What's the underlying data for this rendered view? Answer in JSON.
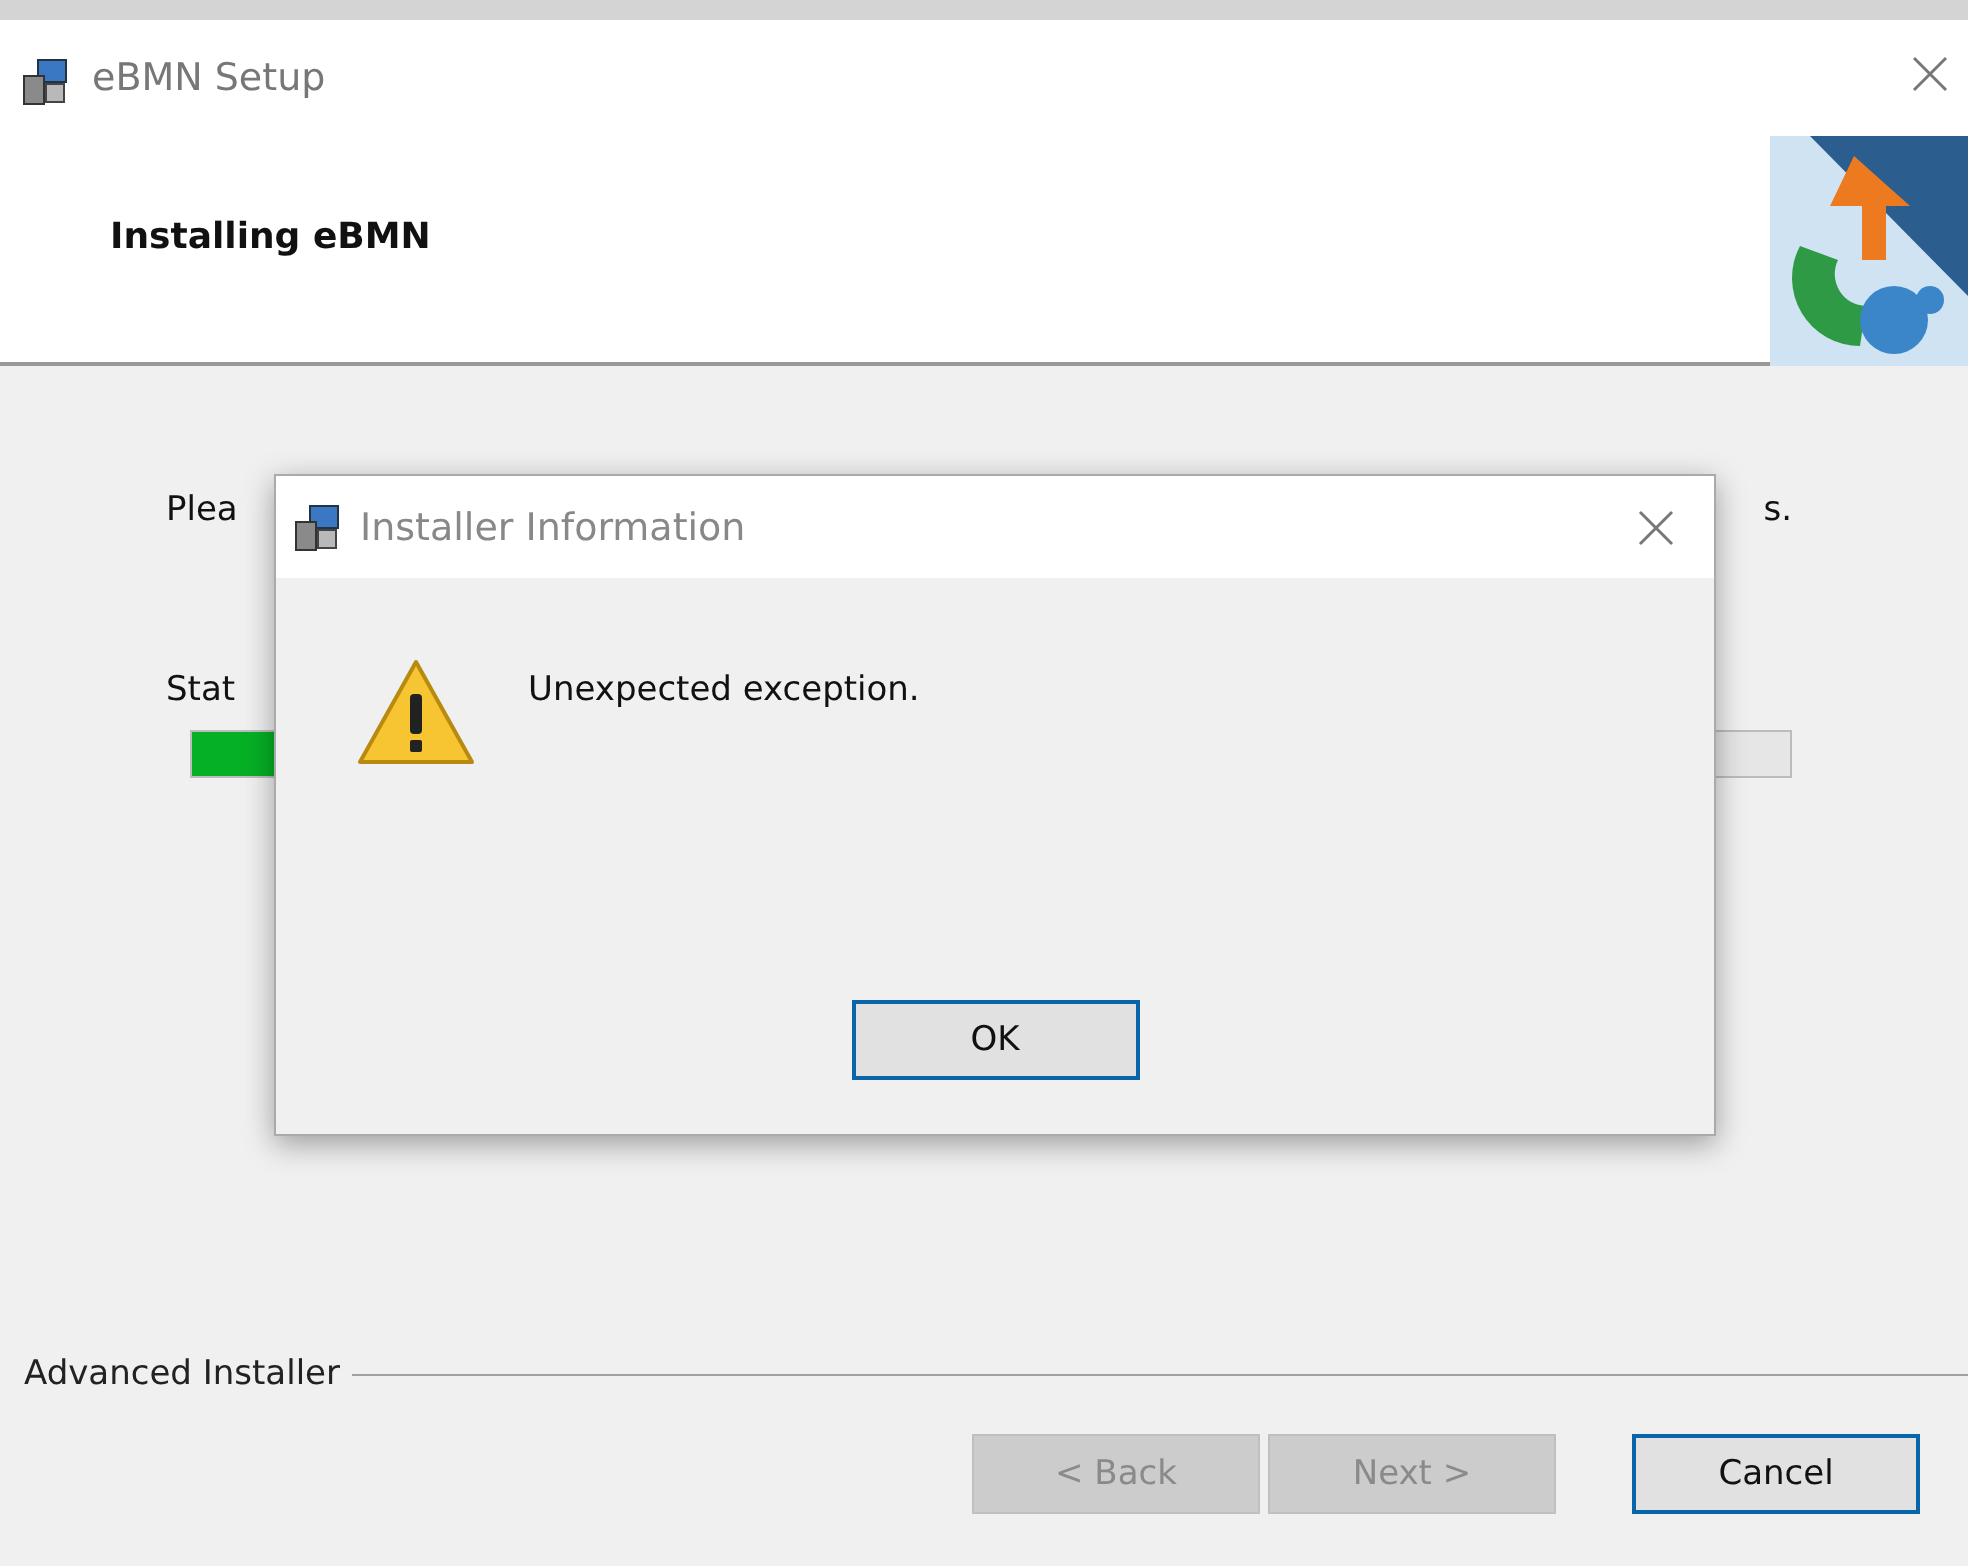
{
  "window": {
    "title": "eBMN Setup"
  },
  "header": {
    "title": "Installing eBMN"
  },
  "body": {
    "message_start": "Plea",
    "message_end": "s.",
    "status_label": "Stat",
    "progress": {
      "level": 0.06
    }
  },
  "footer": {
    "brand": "Advanced Installer",
    "buttons": [
      {
        "label": "< Back",
        "disabled": true,
        "focused": false
      },
      {
        "label": "Next >",
        "disabled": true,
        "focused": false
      },
      {
        "label": "Cancel",
        "disabled": false,
        "focused": true
      }
    ]
  },
  "dialog": {
    "title": "Installer Information",
    "message": "Unexpected exception.",
    "buttons": [
      {
        "label": "OK",
        "disabled": false,
        "focused": true
      }
    ]
  }
}
